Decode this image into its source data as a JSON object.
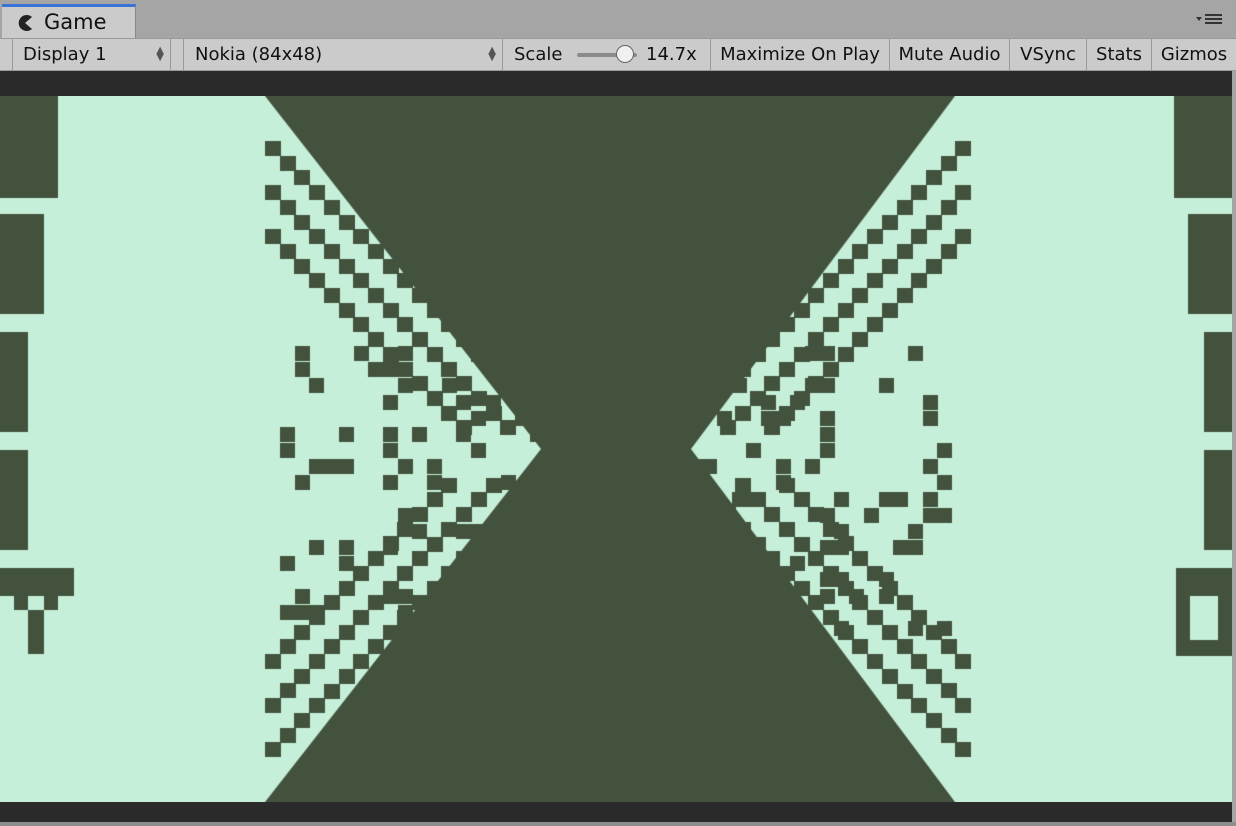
{
  "window": {
    "tab_label": "Game",
    "tab_icon": "pacman-icon",
    "menu_icon": "panel-menu-icon"
  },
  "toolbar": {
    "display": "Display 1",
    "resolution": "Nokia (84x48)",
    "scale_label": "Scale",
    "scale_value": "14.7x",
    "scale_slider_fraction": 0.8,
    "maximize_on_play": "Maximize On Play",
    "mute_audio": "Mute Audio",
    "vsync": "VSync",
    "stats": "Stats",
    "gizmos": "Gizmos"
  },
  "game": {
    "logical_resolution": [
      84,
      48
    ],
    "colors": {
      "light": "#c6efda",
      "dark": "#43523d"
    }
  }
}
